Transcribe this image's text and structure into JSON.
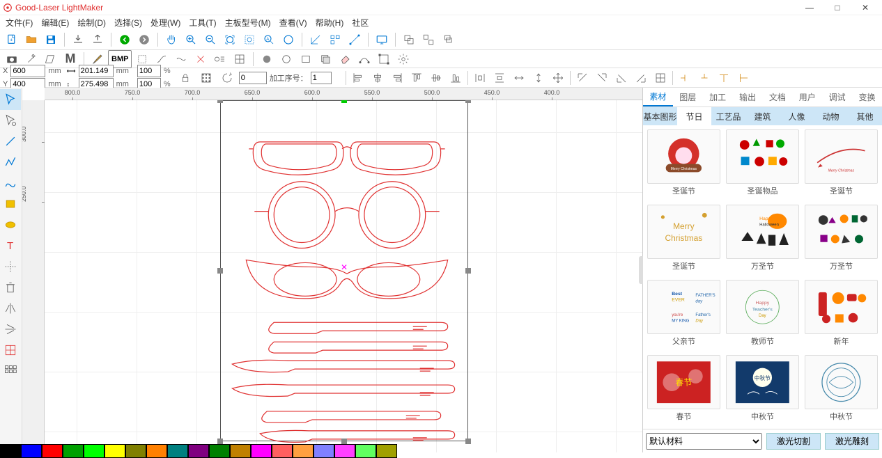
{
  "app_title": "Good-Laser LightMaker",
  "window": {
    "min": "—",
    "max": "□",
    "close": "✕"
  },
  "menu": [
    "文件(F)",
    "编辑(E)",
    "绘制(D)",
    "选择(S)",
    "处理(W)",
    "工具(T)",
    "主板型号(M)",
    "查看(V)",
    "帮助(H)",
    "社区"
  ],
  "coords": {
    "x_label": "X",
    "x_val": "600",
    "y_label": "Y",
    "y_val": "400",
    "w_val": "201.149",
    "h_val": "275.498",
    "sx_val": "100",
    "sy_val": "100",
    "rot_val": "0",
    "seq_label": "加工序号：",
    "seq_val": "1",
    "mm": "mm",
    "pct": "%"
  },
  "ruler_h": [
    "800.0",
    "750.0",
    "700.0",
    "650.0",
    "600.0",
    "550.0",
    "500.0",
    "450.0",
    "400.0"
  ],
  "ruler_v": [
    "300.0",
    "250.0"
  ],
  "right": {
    "tabs1": [
      "素材",
      "图层",
      "加工",
      "输出",
      "文档",
      "用户",
      "调试",
      "变换"
    ],
    "tabs2": [
      "基本图形",
      "节日",
      "工艺品",
      "建筑",
      "人像",
      "动物",
      "其他"
    ],
    "active_tab1": 0,
    "active_tab2": 1,
    "assets": [
      {
        "label": "圣诞节",
        "kind": "santa"
      },
      {
        "label": "圣诞物品",
        "kind": "xmasitems"
      },
      {
        "label": "圣诞节",
        "kind": "sleigh"
      },
      {
        "label": "圣诞节",
        "kind": "merryxmas"
      },
      {
        "label": "万圣节",
        "kind": "halloween1"
      },
      {
        "label": "万圣节",
        "kind": "halloween2"
      },
      {
        "label": "父亲节",
        "kind": "fathers"
      },
      {
        "label": "教师节",
        "kind": "teachers"
      },
      {
        "label": "新年",
        "kind": "newyear"
      },
      {
        "label": "春节",
        "kind": "spring"
      },
      {
        "label": "中秋节",
        "kind": "midautumn1"
      },
      {
        "label": "中秋节",
        "kind": "midautumn2"
      }
    ],
    "material_label": "默认材料",
    "btn_cut": "激光切割",
    "btn_engrave": "激光雕刻"
  },
  "bmp_label": "BMP",
  "colors": [
    "#000000",
    "#0000ff",
    "#ff0000",
    "#00a000",
    "#00ff00",
    "#ffff00",
    "#808000",
    "#ff8000",
    "#008080",
    "#800080",
    "#008000",
    "#c08000",
    "#ff00ff",
    "#ff6060",
    "#ffa040",
    "#8080ff",
    "#ff40ff",
    "#60ff60",
    "#a0a000"
  ]
}
